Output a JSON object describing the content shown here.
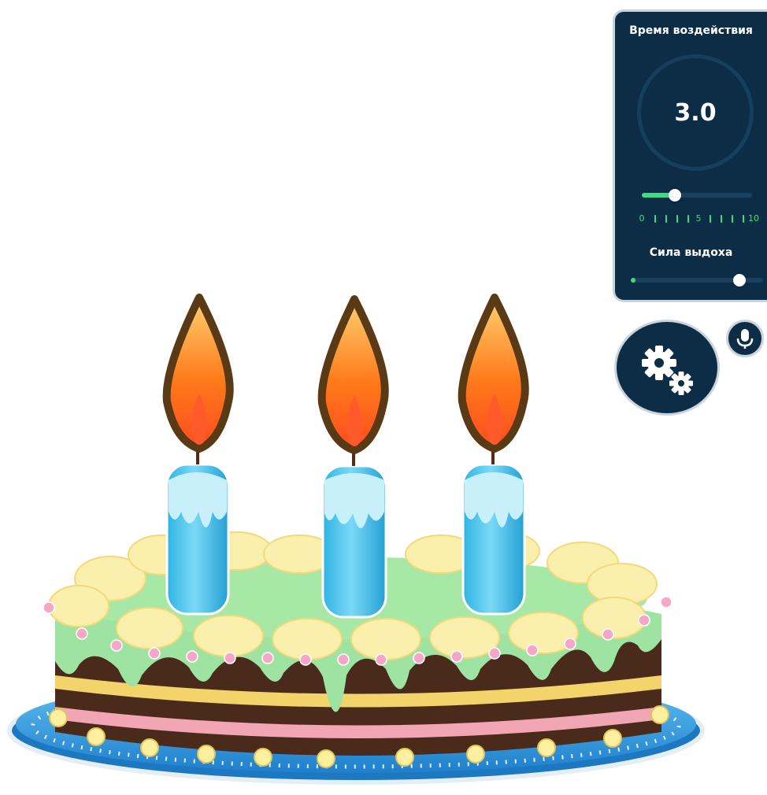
{
  "panel": {
    "exposure_title": "Время воздействия",
    "exposure_value": "3.0",
    "exposure_slider": {
      "min": 0,
      "max": 10,
      "value": 3.0
    },
    "scale_labels": [
      "0",
      "5",
      "10"
    ],
    "breath_title": "Сила выдоха",
    "breath_slider": {
      "value_fraction": 0.82
    }
  },
  "buttons": {
    "settings_icon": "gears-icon",
    "mic_icon": "microphone-icon"
  },
  "colors": {
    "panel_bg": "#0d2c45",
    "accent_green": "#3ddc84",
    "candle_blue": "#4cc3ea",
    "icing_green": "#9ee3a2",
    "plate_blue": "#2a8fd6"
  }
}
